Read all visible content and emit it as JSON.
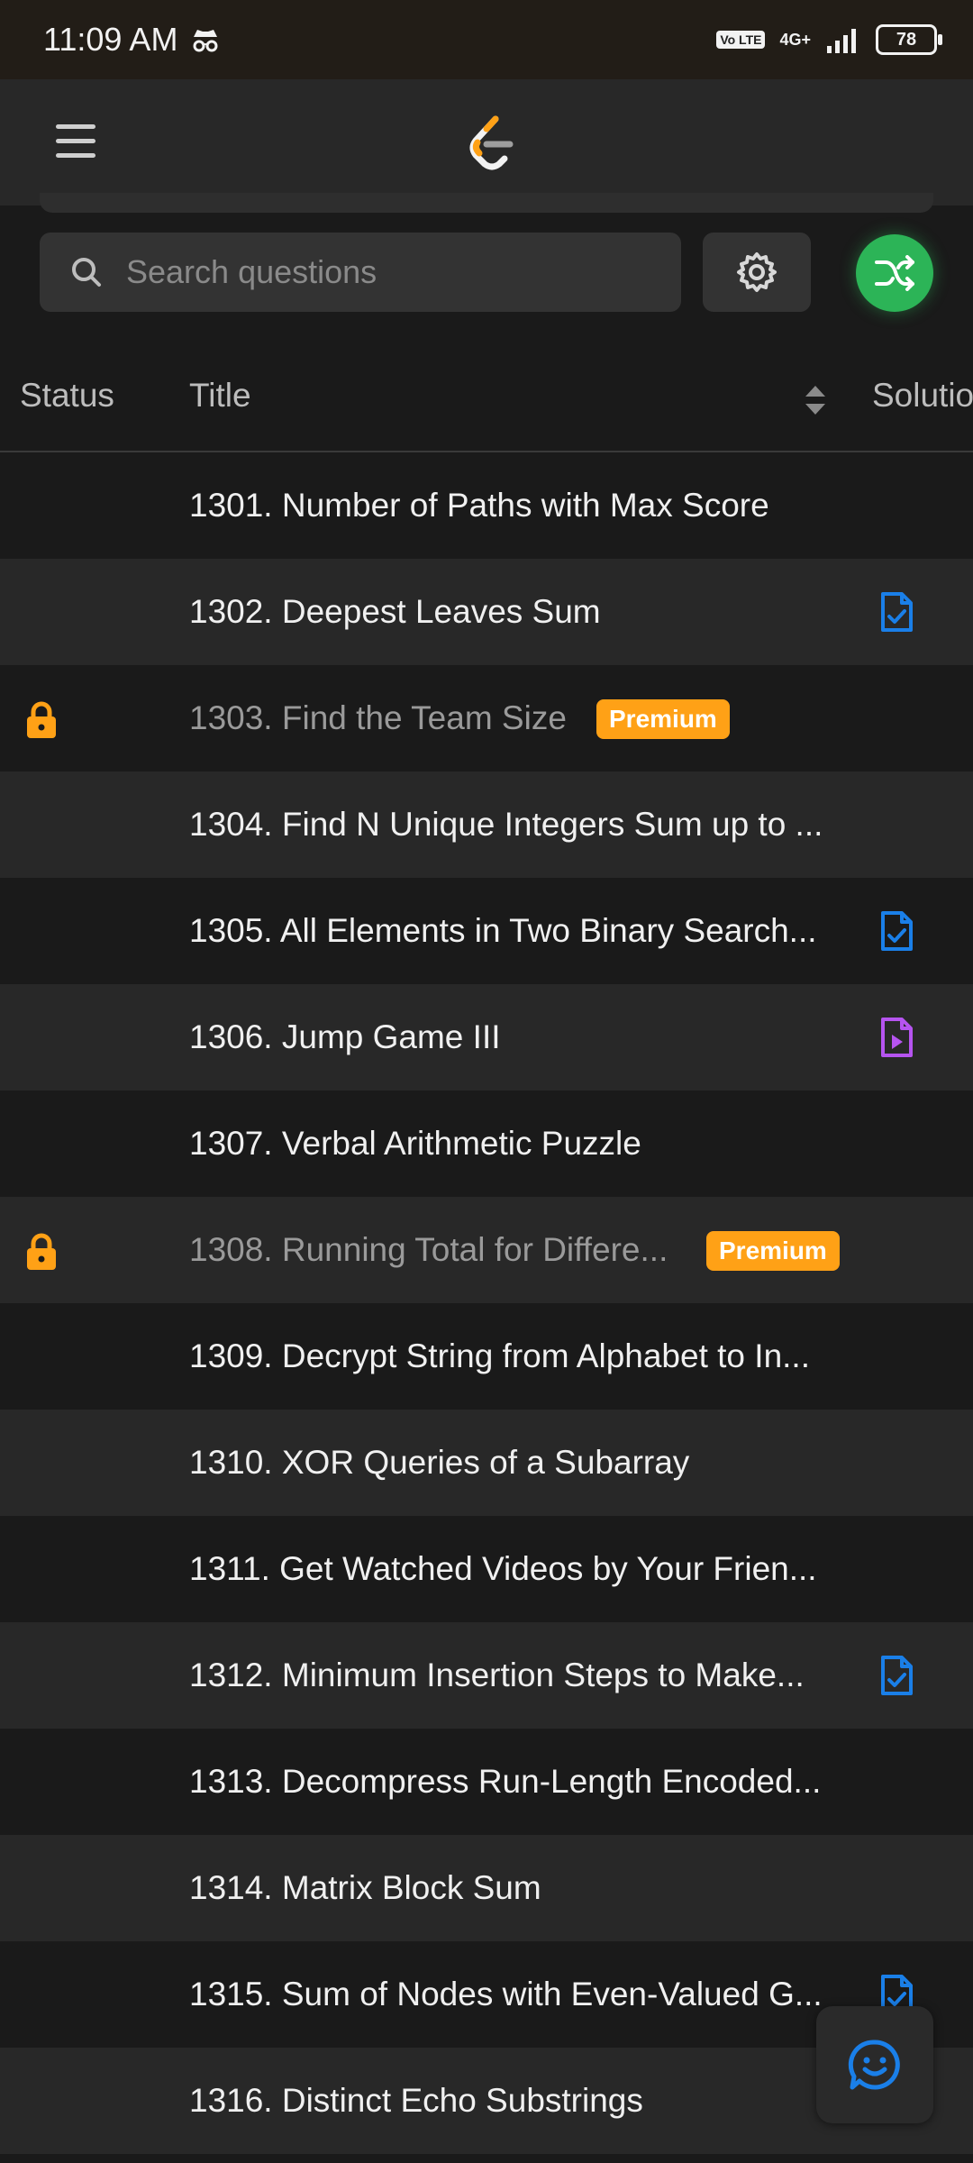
{
  "status_bar": {
    "time": "11:09 AM",
    "volte": "Vo LTE",
    "network": "4G+",
    "battery": "78",
    "icons": [
      "incognito-icon",
      "signal-icon",
      "battery-icon"
    ]
  },
  "app_bar": {
    "menu_icon": "hamburger-menu-icon",
    "logo": "leetcode-logo"
  },
  "search": {
    "placeholder": "Search questions",
    "value": "",
    "settings_icon": "gear-icon",
    "shuffle_icon": "shuffle-icon"
  },
  "colors": {
    "accent_orange": "#ffa116",
    "shuffle_green": "#2cb457",
    "solution_blue": "#1a7fe8",
    "video_purple": "#b654f0"
  },
  "table": {
    "headers": {
      "status": "Status",
      "title": "Title",
      "solution": "Solution"
    },
    "rows": [
      {
        "title": "1301. Number of Paths with Max Score",
        "locked": false,
        "premium": "",
        "solution": ""
      },
      {
        "title": "1302. Deepest Leaves Sum",
        "locked": false,
        "premium": "",
        "solution": "article"
      },
      {
        "title": "1303. Find the Team Size",
        "locked": true,
        "premium": "Premium",
        "solution": ""
      },
      {
        "title": "1304. Find N Unique Integers Sum up to ...",
        "locked": false,
        "premium": "",
        "solution": ""
      },
      {
        "title": "1305. All Elements in Two Binary Search...",
        "locked": false,
        "premium": "",
        "solution": "article"
      },
      {
        "title": "1306. Jump Game III",
        "locked": false,
        "premium": "",
        "solution": "video"
      },
      {
        "title": "1307. Verbal Arithmetic Puzzle",
        "locked": false,
        "premium": "",
        "solution": ""
      },
      {
        "title": "1308. Running Total for Differe...",
        "locked": true,
        "premium": "Premium",
        "solution": ""
      },
      {
        "title": "1309. Decrypt String from Alphabet to In...",
        "locked": false,
        "premium": "",
        "solution": ""
      },
      {
        "title": "1310. XOR Queries of a Subarray",
        "locked": false,
        "premium": "",
        "solution": ""
      },
      {
        "title": "1311. Get Watched Videos by Your Frien...",
        "locked": false,
        "premium": "",
        "solution": ""
      },
      {
        "title": "1312. Minimum Insertion Steps to Make...",
        "locked": false,
        "premium": "",
        "solution": "article"
      },
      {
        "title": "1313. Decompress Run-Length Encoded...",
        "locked": false,
        "premium": "",
        "solution": ""
      },
      {
        "title": "1314. Matrix Block Sum",
        "locked": false,
        "premium": "",
        "solution": ""
      },
      {
        "title": "1315. Sum of Nodes with Even-Valued G...",
        "locked": false,
        "premium": "",
        "solution": "article"
      },
      {
        "title": "1316. Distinct Echo Substrings",
        "locked": false,
        "premium": "",
        "solution": ""
      }
    ]
  },
  "fab": {
    "icon": "feedback-smile-icon"
  }
}
